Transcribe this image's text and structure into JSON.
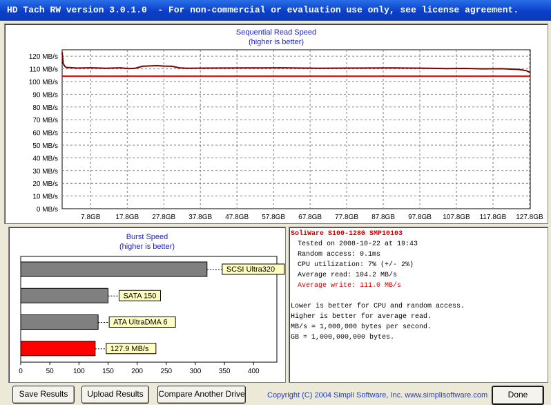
{
  "window": {
    "title": "HD Tach RW version 3.0.1.0  - For non-commercial or evaluation use only, see license agreement."
  },
  "read_chart": {
    "title": "Sequential Read Speed",
    "subtitle": "(higher is better)",
    "colors": {
      "line": "#7a0000",
      "avg": "#cc0000",
      "grid": "#808080"
    }
  },
  "burst_chart": {
    "title": "Burst Speed",
    "subtitle": "(higher is better)"
  },
  "info": {
    "drive": "SoliWare S100-128G SMP10103",
    "tested": "Tested on 2008-10-22 at 19:43",
    "random_access": "Random access: 0.1ms",
    "cpu": "CPU utilization: 7% (+/- 2%)",
    "avg_read": "Average read: 104.2 MB/s",
    "avg_write": "Average write: 111.0 MB/s",
    "note1": "Lower is better for CPU and random access.",
    "note2": "Higher is better for average read.",
    "note3": "MB/s = 1,000,000 bytes per second.",
    "note4": "GB = 1,000,000,000 bytes."
  },
  "buttons": {
    "save": "Save Results",
    "upload": "Upload Results",
    "compare": "Compare Another Drive",
    "done": "Done"
  },
  "copyright": "Copyright (C) 2004 Simpli Software, Inc. www.simplisoftware.com",
  "chart_data": [
    {
      "type": "line",
      "title": "Sequential Read Speed",
      "subtitle": "(higher is better)",
      "y_ticks": [
        "0 MB/s",
        "10 MB/s",
        "20 MB/s",
        "30 MB/s",
        "40 MB/s",
        "50 MB/s",
        "60 MB/s",
        "70 MB/s",
        "80 MB/s",
        "90 MB/s",
        "100 MB/s",
        "110 MB/s",
        "120 MB/s"
      ],
      "x_ticks": [
        "7.8GB",
        "17.8GB",
        "27.8GB",
        "37.8GB",
        "47.8GB",
        "57.8GB",
        "67.8GB",
        "77.8GB",
        "87.8GB",
        "97.8GB",
        "107.8GB",
        "117.8GB",
        "127.8GB"
      ],
      "ylim": [
        0,
        125
      ],
      "xlim": [
        0,
        128
      ],
      "grid": true,
      "series": [
        {
          "name": "",
          "x": [
            0,
            0.3,
            0.7,
            1.2,
            2,
            4,
            8,
            12,
            16,
            18,
            20,
            22,
            24,
            26,
            28,
            30,
            32,
            34,
            40,
            50,
            60,
            70,
            80,
            90,
            100,
            105,
            110,
            115,
            120,
            125,
            127,
            128
          ],
          "y": [
            123,
            114,
            112,
            111,
            111,
            110.6,
            110.8,
            110.5,
            110.8,
            110.2,
            110.5,
            112,
            112.3,
            112.5,
            112.2,
            112,
            110.8,
            110.5,
            110.6,
            110.7,
            110.8,
            110.5,
            110.6,
            110.7,
            110.5,
            110.2,
            110.3,
            110,
            110.1,
            109.5,
            108.5,
            107
          ]
        }
      ],
      "average_line": 104.2
    },
    {
      "type": "bar",
      "title": "Burst Speed",
      "subtitle": "(higher is better)",
      "orientation": "horizontal",
      "categories": [
        "SCSI Ultra320",
        "SATA 150",
        "ATA UltraDMA 6",
        "127.9 MB/s"
      ],
      "values": [
        320,
        150,
        133,
        127.9
      ],
      "colors": [
        "#808080",
        "#808080",
        "#808080",
        "#ff0000"
      ],
      "x_ticks": [
        0,
        50,
        100,
        150,
        200,
        250,
        300,
        350,
        400
      ],
      "xlim": [
        0,
        440
      ],
      "grid": false
    }
  ]
}
